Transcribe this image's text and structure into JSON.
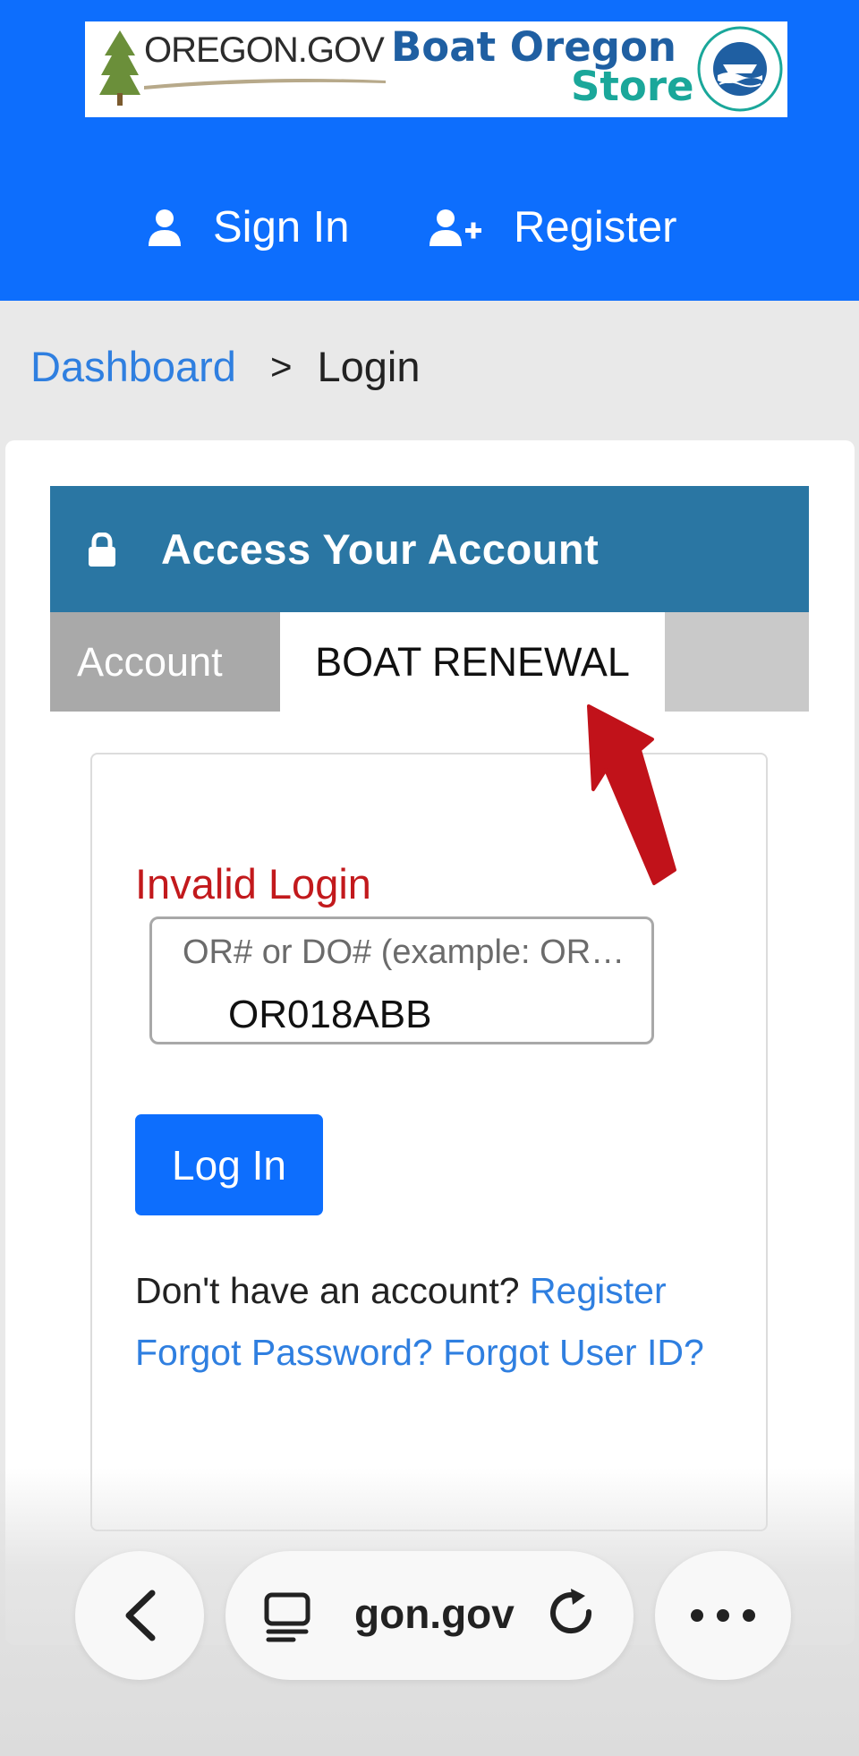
{
  "header": {
    "banner": {
      "oregon_gov": "OREGON.GOV",
      "store_title_line1": "Boat Oregon",
      "store_title_line2": "Store",
      "seal_alt": "OREGON STATE MARINE BOARD"
    },
    "nav": {
      "sign_in": "Sign In",
      "register": "Register"
    }
  },
  "breadcrumb": {
    "dashboard": "Dashboard",
    "separator": ">",
    "current": "Login"
  },
  "panel": {
    "title": "Access Your Account",
    "tabs": {
      "account": "Account",
      "boat_renewal": "BOAT RENEWAL"
    }
  },
  "form": {
    "error": "Invalid Login",
    "id_field": {
      "placeholder": "OR# or DO# (example: OR…",
      "value": "OR018ABB"
    },
    "login_button": "Log In",
    "no_account_text": "Don't have an account?",
    "register_link": "Register",
    "forgot_password": "Forgot Password?",
    "forgot_user_id": "Forgot User ID?"
  },
  "browser": {
    "url": "gon.gov"
  },
  "colors": {
    "header_blue": "#0d6efd",
    "panel_blue": "#2a76a3",
    "error_red": "#c2191c",
    "link_blue": "#2f7fe0",
    "arrow_red": "#c1121a"
  }
}
